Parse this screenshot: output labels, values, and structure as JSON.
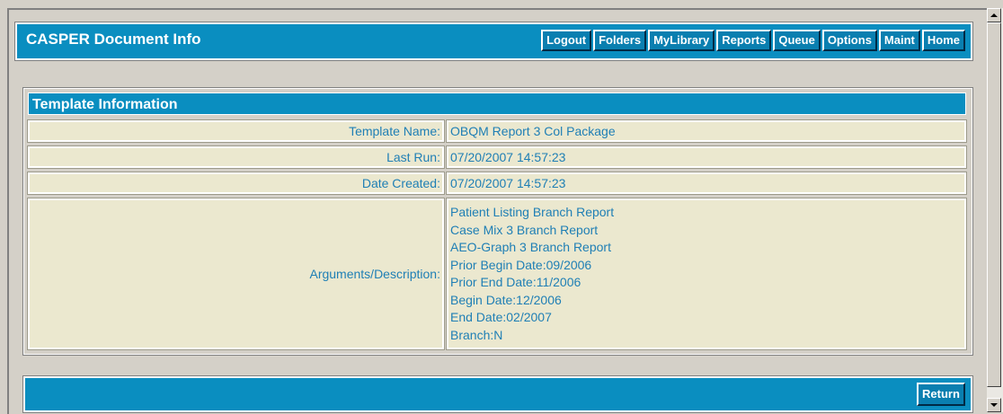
{
  "header": {
    "title": "CASPER Document Info",
    "nav": [
      "Logout",
      "Folders",
      "MyLibrary",
      "Reports",
      "Queue",
      "Options",
      "Maint",
      "Home"
    ]
  },
  "panel": {
    "title": "Template Information",
    "rows": [
      {
        "label": "Template Name:",
        "value": "OBQM Report 3 Col Package"
      },
      {
        "label": "Last Run:",
        "value": "07/20/2007 14:57:23"
      },
      {
        "label": "Date Created:",
        "value": "07/20/2007 14:57:23"
      }
    ],
    "arguments": {
      "label": "Arguments/Description:",
      "lines": [
        "Patient Listing Branch Report",
        "Case Mix 3 Branch Report",
        "AEO-Graph 3 Branch Report",
        "Prior Begin Date:09/2006",
        "Prior End Date:11/2006",
        "Begin Date:12/2006",
        "End Date:02/2007",
        "Branch:N"
      ]
    }
  },
  "footer": {
    "return_label": "Return"
  },
  "colors": {
    "bar_blue": "#0a8ec0",
    "cell_bg": "#ebe8cf",
    "cell_text": "#1f7fb5",
    "chrome": "#d4d0c8"
  }
}
